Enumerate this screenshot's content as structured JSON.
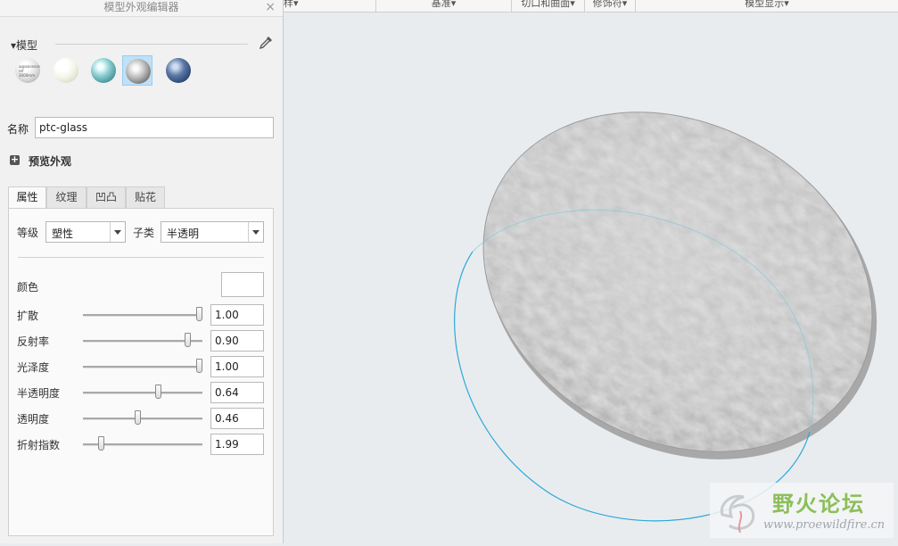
{
  "panel": {
    "title": "模型外观编辑器",
    "close_glyph": "×",
    "model_section_label": "▾模型",
    "dropper_icon": "eyedropper-icon",
    "thumb_text": "ptc-glass",
    "swatches": [
      {
        "name": "swatch-texture",
        "selected": false,
        "tiny_text": "appearance ref 3000mm"
      },
      {
        "name": "swatch-white",
        "selected": false
      },
      {
        "name": "swatch-teal",
        "selected": false
      },
      {
        "name": "swatch-glass",
        "selected": true
      },
      {
        "name": "swatch-blue",
        "selected": false
      }
    ],
    "name_label": "名称",
    "name_value": "ptc-glass",
    "preview_label": "预览外观",
    "preview_icon": "+",
    "tabs": [
      {
        "label": "属性",
        "active": true
      },
      {
        "label": "纹理",
        "active": false
      },
      {
        "label": "凹凸",
        "active": false
      },
      {
        "label": "贴花",
        "active": false
      }
    ],
    "grade_label": "等级",
    "grade_value": "塑性",
    "subtype_label": "子类",
    "subtype_value": "半透明",
    "color_label": "颜色",
    "color_value": "#ffffff",
    "properties": [
      {
        "label": "扩散",
        "value": "1.00",
        "fraction": 1.0
      },
      {
        "label": "反射率",
        "value": "0.90",
        "fraction": 0.9
      },
      {
        "label": "光泽度",
        "value": "1.00",
        "fraction": 1.0
      },
      {
        "label": "半透明度",
        "value": "0.64",
        "fraction": 0.64
      },
      {
        "label": "透明度",
        "value": "0.46",
        "fraction": 0.46
      },
      {
        "label": "折射指数",
        "value": "1.99",
        "fraction": 0.14
      }
    ]
  },
  "toolbar": {
    "items": [
      "样▾",
      "基准▾",
      "切口和曲面▾",
      "修饰符▾",
      "模型显示▾"
    ]
  },
  "watermark": {
    "title": "野火论坛",
    "url": "www.proewildfire.cn"
  }
}
